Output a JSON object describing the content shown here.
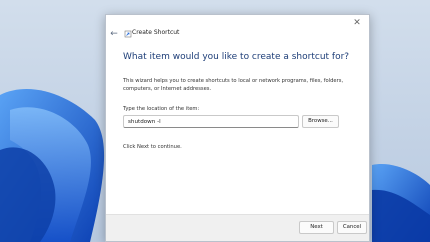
{
  "window": {
    "title": "Create Shortcut",
    "back_icon": "back-arrow-icon",
    "close_icon": "close-icon"
  },
  "wizard": {
    "heading": "What item would you like to create a shortcut for?",
    "description": "This wizard helps you to create shortcuts to local or network programs, files, folders, computers, or Internet addresses.",
    "location_label": "Type the location of the item:",
    "location_value": "shutdown -l",
    "browse_label": "Browse...",
    "hint": "Click Next to continue."
  },
  "footer": {
    "next_label": "Next",
    "cancel_label": "Cancel"
  },
  "colors": {
    "heading": "#1e3e78",
    "wallpaper_accent": "#1a5fd6"
  }
}
